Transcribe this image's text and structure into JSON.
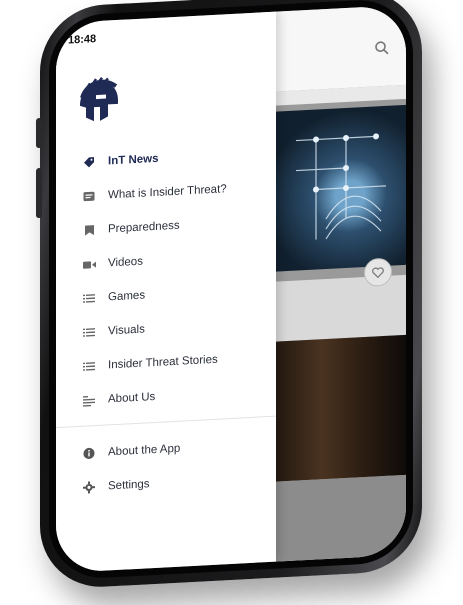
{
  "status_bar": {
    "time": "18:48"
  },
  "drawer": {
    "menu_items": [
      {
        "label": "InT News",
        "icon": "tag-icon",
        "active": true
      },
      {
        "label": "What is Insider Threat?",
        "icon": "info-card-icon",
        "active": false
      },
      {
        "label": "Preparedness",
        "icon": "bookmark-icon",
        "active": false
      },
      {
        "label": "Videos",
        "icon": "video-icon",
        "active": false
      },
      {
        "label": "Games",
        "icon": "list-icon",
        "active": false
      },
      {
        "label": "Visuals",
        "icon": "list-icon",
        "active": false
      },
      {
        "label": "Insider Threat Stories",
        "icon": "list-icon",
        "active": false
      },
      {
        "label": "About Us",
        "icon": "text-list-icon",
        "active": false
      }
    ],
    "secondary_items": [
      {
        "label": "About the App",
        "icon": "info-circle-icon"
      },
      {
        "label": "Settings",
        "icon": "gear-icon"
      }
    ]
  },
  "colors": {
    "accent": "#1f2a55",
    "text": "#2b2f3a",
    "drawer_bg": "#ffffff"
  }
}
